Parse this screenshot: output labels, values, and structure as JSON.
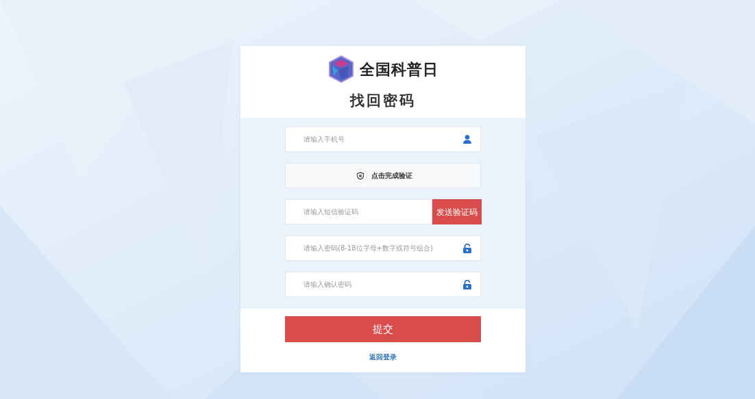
{
  "brand": {
    "name": "全国科普日"
  },
  "title": "找回密码",
  "fields": [
    {
      "kind": "phone",
      "placeholder": "请输入手机号"
    },
    {
      "kind": "captcha",
      "label": "点击完成验证"
    },
    {
      "kind": "sms",
      "placeholder": "请输入短信验证码",
      "button": "发送验证码"
    },
    {
      "kind": "password",
      "placeholder": "请输入密码(8-18位字母+数字或符号组合)"
    },
    {
      "kind": "password",
      "placeholder": "请输入确认密码"
    }
  ],
  "submit": "提交",
  "back_link": "返回登录"
}
